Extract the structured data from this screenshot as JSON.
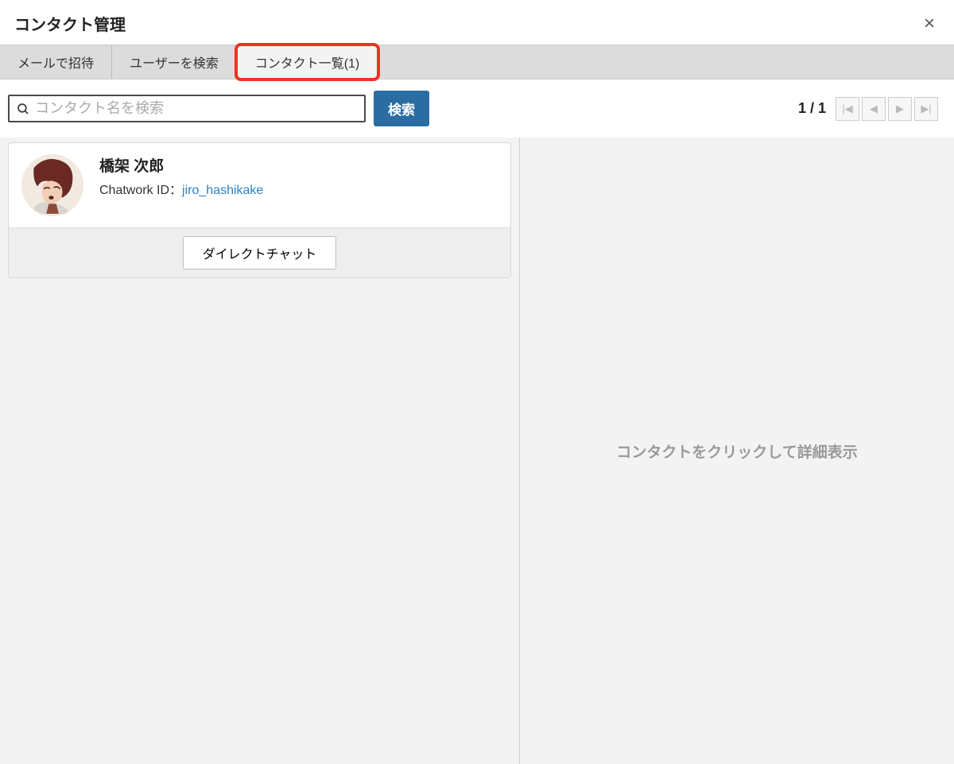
{
  "header": {
    "title": "コンタクト管理"
  },
  "tabs": {
    "invite": "メールで招待",
    "search_user": "ユーザーを検索",
    "contact_list": "コンタクト一覧(1)"
  },
  "search": {
    "placeholder": "コンタクト名を検索",
    "button": "検索"
  },
  "pagination": {
    "indicator": "1 / 1"
  },
  "contact": {
    "name": "橋架 次郎",
    "id_label": "Chatwork ID：",
    "id_value": "jiro_hashikake",
    "direct_chat": "ダイレクトチャット"
  },
  "detail": {
    "placeholder": "コンタクトをクリックして詳細表示"
  }
}
